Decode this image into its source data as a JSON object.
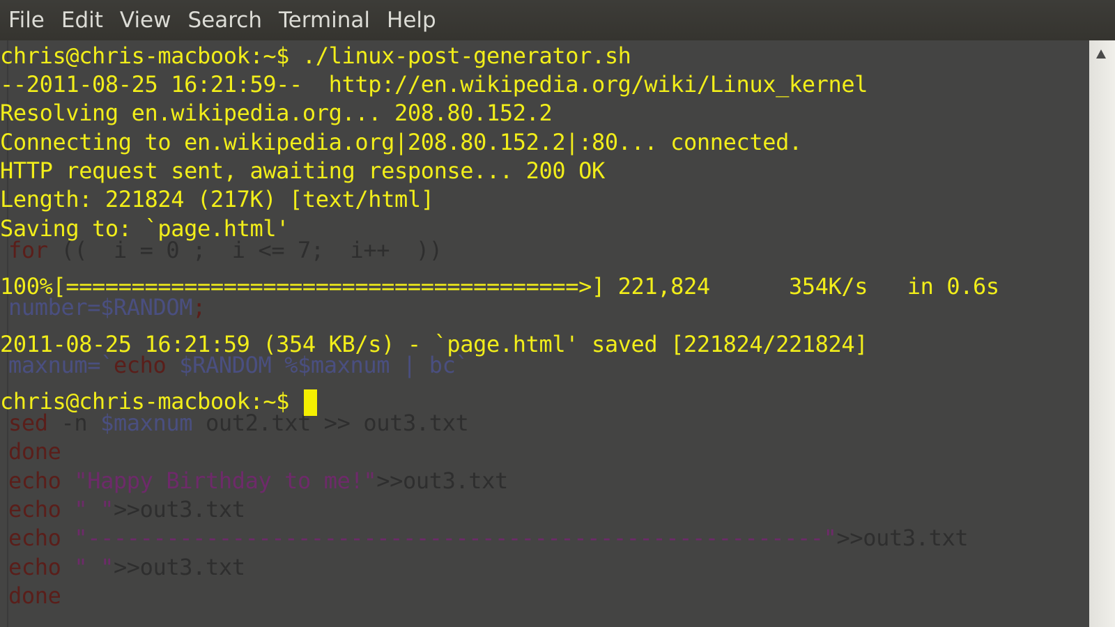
{
  "menu": [
    "File",
    "Edit",
    "View",
    "Search",
    "Terminal",
    "Help"
  ],
  "terminal": {
    "output": [
      "chris@chris-macbook:~$ ./linux-post-generator.sh",
      "--2011-08-25 16:21:59--  http://en.wikipedia.org/wiki/Linux_kernel",
      "Resolving en.wikipedia.org... 208.80.152.2",
      "Connecting to en.wikipedia.org|208.80.152.2|:80... connected.",
      "HTTP request sent, awaiting response... 200 OK",
      "Length: 221824 (217K) [text/html]",
      "Saving to: `page.html'",
      "100%[=======================================>] 221,824      354K/s   in 0.6s",
      "2011-08-25 16:21:59 (354 KB/s) - `page.html' saved [221824/221824]",
      "chris@chris-macbook:~$ "
    ],
    "background_script": {
      "for_line": {
        "kw": "for",
        "rest": " ((  i = 0 ;  i <= 7;  i++  ))"
      },
      "number_line": {
        "a": "number=",
        "b": "$RANDOM",
        "c": ";"
      },
      "maxnum_line": {
        "a": "maxnum=`",
        "kw": "echo",
        "b": " $RANDOM %$maxnum | bc`"
      },
      "sed_line": {
        "kw": "sed",
        "a": " -n ",
        "var": "$maxnum",
        "b": " out2.txt >> out3.txt"
      },
      "done1": "done",
      "echo1": {
        "kw": "echo",
        "str": " \"Happy Birthday to me!\"",
        "rest": ">>out3.txt"
      },
      "echo2": {
        "kw": "echo",
        "str": " \" \"",
        "rest": ">>out3.txt"
      },
      "echo3": {
        "kw": "echo",
        "str": " \"--------------------------------------------------------\"",
        "rest": ">>out3.txt"
      },
      "echo4": {
        "kw": "echo",
        "str": " \" \"",
        "rest": ">>out3.txt"
      },
      "done2": "done"
    }
  },
  "colors": {
    "foreground": "#f2ee1a",
    "background": "#444443",
    "keyword": "#5a1e1a",
    "variable": "#4a4f80",
    "string": "#6e2a6a"
  }
}
